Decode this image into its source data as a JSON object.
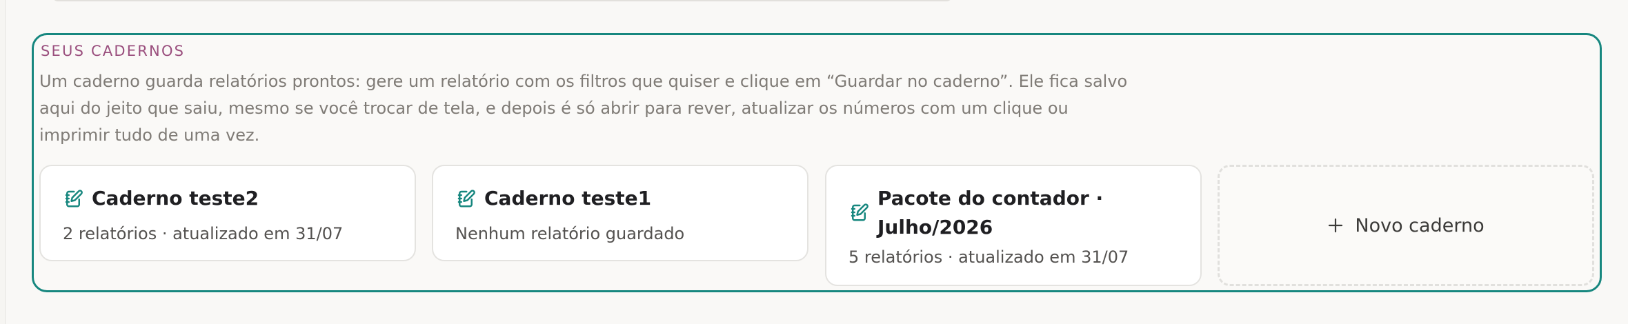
{
  "section": {
    "eyebrow": "SEUS CADERNOS",
    "description": "Um caderno guarda relatórios prontos: gere um relatório com os filtros que quiser e clique em “Guardar no caderno”. Ele fica salvo aqui do jeito que saiu, mesmo se você trocar de tela, e depois é só abrir para rever, atualizar os números com um clique ou imprimir tudo de uma vez."
  },
  "notebooks": [
    {
      "icon": "notebook-edit-icon",
      "title": "Caderno teste2",
      "meta": "2 relatórios · atualizado em 31/07"
    },
    {
      "icon": "notebook-edit-icon",
      "title": "Caderno teste1",
      "meta": "Nenhum relatório guardado"
    },
    {
      "icon": "notebook-edit-icon",
      "title": "Pacote do contador · Julho/2026",
      "meta": "5 relatórios · atualizado em 31/07"
    }
  ],
  "new_notebook": {
    "icon": "plus-icon",
    "label": "Novo caderno"
  },
  "colors": {
    "accent": "#17877f",
    "eyebrow": "#9a4f7e",
    "muted_text": "#7f7b76"
  }
}
